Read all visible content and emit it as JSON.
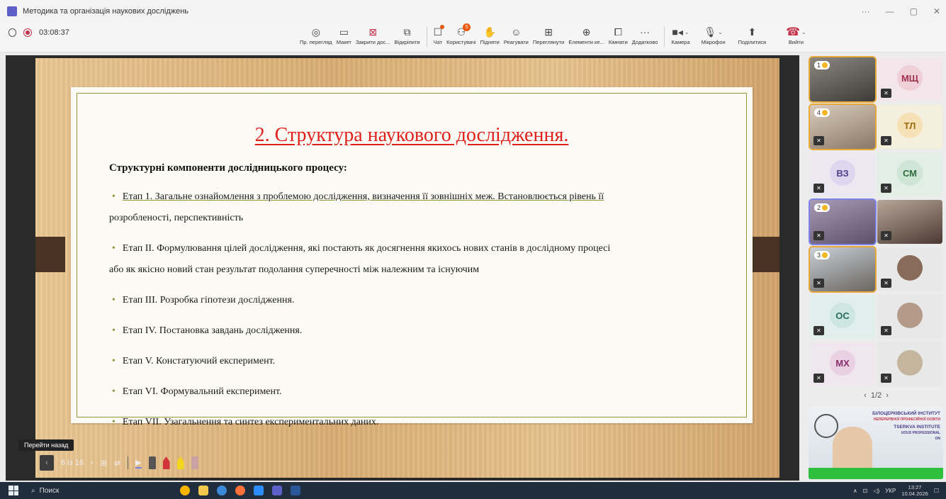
{
  "window": {
    "title": "Методика та організація наукових досліджень",
    "controls": [
      "···",
      "—",
      "▢",
      "✕"
    ]
  },
  "recording": {
    "time": "03:08:37"
  },
  "toolbar": {
    "items": [
      {
        "label": "Пр. перегляд",
        "icon": "eye-icon"
      },
      {
        "label": "Макет",
        "icon": "layout-icon"
      },
      {
        "label": "Закрити дос...",
        "icon": "close-content-icon"
      },
      {
        "label": "Відкріпити",
        "icon": "unpin-icon"
      },
      {
        "label": "Чат",
        "icon": "chat-icon"
      },
      {
        "label": "Користувачі",
        "icon": "people-icon",
        "count": "5"
      },
      {
        "label": "Підняти",
        "icon": "raise-hand-icon"
      },
      {
        "label": "Реагувати",
        "icon": "smile-icon"
      },
      {
        "label": "Переглянути",
        "icon": "grid-view-icon"
      },
      {
        "label": "Елементи ке...",
        "icon": "apps-icon"
      },
      {
        "label": "Кімнати",
        "icon": "rooms-icon"
      },
      {
        "label": "Додатково",
        "icon": "more-icon"
      },
      {
        "label": "Камера",
        "icon": "camera-icon"
      },
      {
        "label": "Мікрофон",
        "icon": "mic-icon"
      },
      {
        "label": "Поділитися",
        "icon": "share-icon"
      },
      {
        "label": "Вийти",
        "icon": "leave-icon"
      }
    ]
  },
  "slide": {
    "title": "2. Структура наукового дослідження.",
    "subtitle": "Структурні компоненти дослідницького процесу:",
    "bullets": [
      "Етап 1. Загальне ознайомлення з проблемою дослідження, визначення її зовнішніх меж. Встановлюється рівень її",
      "розробленості, перспективність",
      "Етап ІІ. Формулювання цілей дослідження, які постають як досягнення якихось нових станів в дослідному процесі",
      "або як якісно новий стан результат подолання суперечності між належним та існуючим",
      "Етап ІІІ. Розробка гіпотези дослідження.",
      "Етап ІV. Постановка завдань дослідження.",
      "Етап V. Констатуючий експеримент.",
      "Етап VІ. Формувальний експеримент.",
      "Етап VІІ. Узагальнення та синтез експериментальних даних."
    ]
  },
  "slide_controls": {
    "tooltip": "Перейти назад",
    "page": "6 із 16"
  },
  "participants": {
    "tiles": [
      {
        "initials": "",
        "hand": "1"
      },
      {
        "initials": "МЩ"
      },
      {
        "initials": "",
        "hand": "4"
      },
      {
        "initials": "ТЛ"
      },
      {
        "initials": "ВЗ"
      },
      {
        "initials": "СМ"
      },
      {
        "initials": "",
        "hand": "2"
      },
      {
        "initials": ""
      },
      {
        "initials": "",
        "hand": "3"
      },
      {
        "initials": ""
      },
      {
        "initials": "ОС"
      },
      {
        "initials": ""
      },
      {
        "initials": "МХ"
      },
      {
        "initials": ""
      }
    ],
    "pager": "1/2",
    "presenter_banner": [
      "БІЛОЦЕРКІВСЬКИЙ ІНСТИТУТ",
      "НЕПЕРЕРВНОЇ ПРОФЕСІЙНОЇ ОСВІТИ",
      "TSERKVA INSTITUTE",
      "UOUS PROFESSIONAL",
      "ON"
    ]
  },
  "taskbar": {
    "search": "Поиск",
    "lang": "УКР",
    "time": "13:27",
    "date": "10.04.2026"
  }
}
